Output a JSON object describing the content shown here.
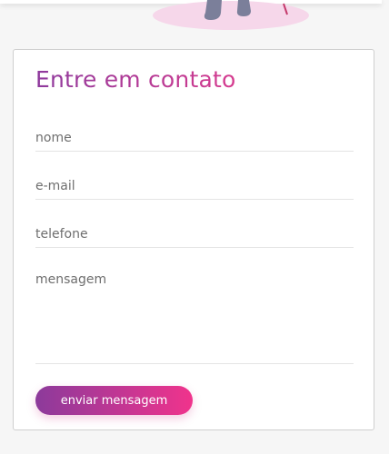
{
  "contact_form": {
    "title": "Entre em contato",
    "name_placeholder": "nome",
    "email_placeholder": "e-mail",
    "phone_placeholder": "telefone",
    "message_placeholder": "mensagem",
    "submit_label": "enviar mensagem"
  },
  "colors": {
    "accent_start": "#8c3a9b",
    "accent_end": "#f0338c",
    "illustration_shadow": "#f6d7ea",
    "illustration_figure": "#7b7f9a"
  }
}
